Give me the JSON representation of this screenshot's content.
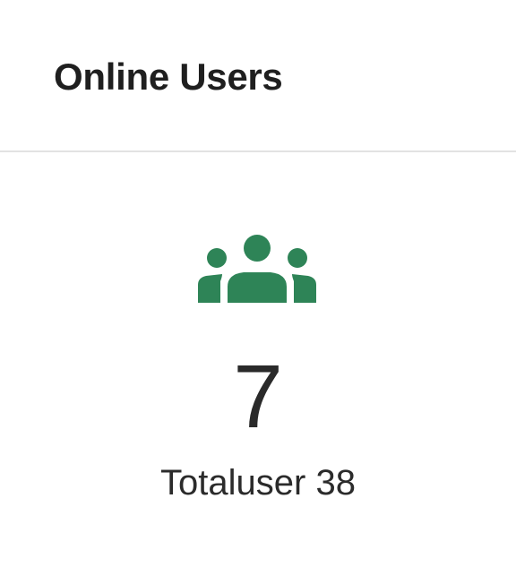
{
  "card": {
    "title": "Online Users",
    "icon": "users-group-icon",
    "online_count": "7",
    "total_label": "Totaluser",
    "total_count": "38",
    "accent_color": "#2e8457"
  }
}
